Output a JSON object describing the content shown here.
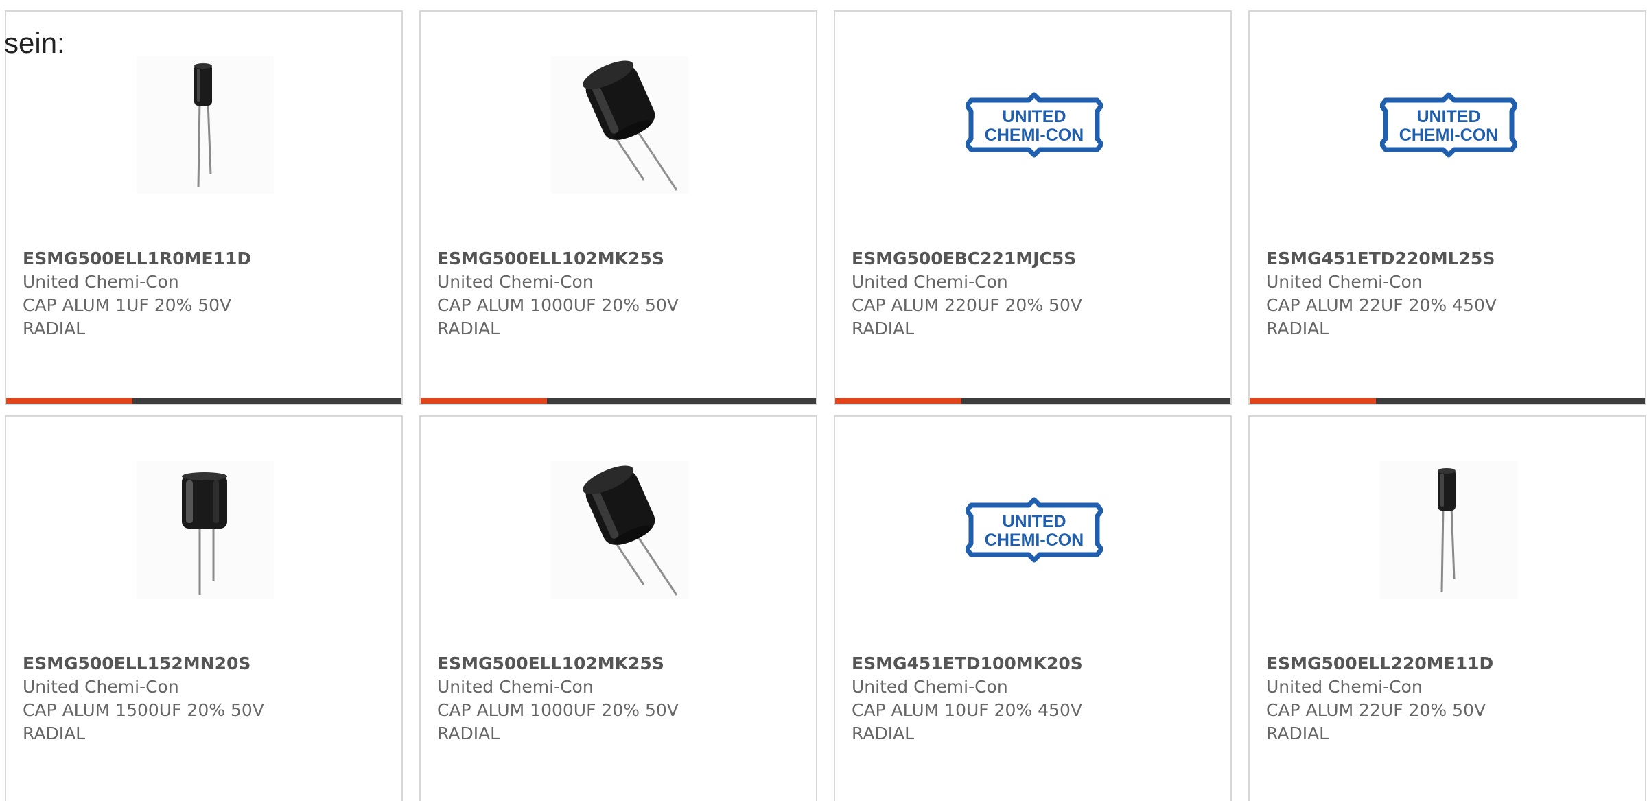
{
  "intro_text": "sein:",
  "colors": {
    "accent": "#e24419",
    "bar_track": "#3c3c3c",
    "card_border": "#d8d8d8",
    "logo_blue": "#1f5fae"
  },
  "products": [
    {
      "part_number": "ESMG500ELL1R0ME11D",
      "manufacturer": "United Chemi-Con",
      "description": "CAP ALUM 1UF 20% 50V RADIAL",
      "image": "capacitor-small-icon",
      "progress": 0.32
    },
    {
      "part_number": "ESMG500ELL102MK25S",
      "manufacturer": "United Chemi-Con",
      "description": "CAP ALUM 1000UF 20% 50V RADIAL",
      "image": "capacitor-tilted-icon",
      "progress": 0.32
    },
    {
      "part_number": "ESMG500EBC221MJC5S",
      "manufacturer": "United Chemi-Con",
      "description": "CAP ALUM 220UF 20% 50V RADIAL",
      "image": "united-chemi-con-logo",
      "progress": 0.32
    },
    {
      "part_number": "ESMG451ETD220ML25S",
      "manufacturer": "United Chemi-Con",
      "description": "CAP ALUM 22UF 20% 450V RADIAL",
      "image": "united-chemi-con-logo",
      "progress": 0.32
    },
    {
      "part_number": "ESMG500ELL152MN20S",
      "manufacturer": "United Chemi-Con",
      "description": "CAP ALUM 1500UF 20% 50V RADIAL",
      "image": "capacitor-wide-icon",
      "progress": 0.32
    },
    {
      "part_number": "ESMG500ELL102MK25S",
      "manufacturer": "United Chemi-Con",
      "description": "CAP ALUM 1000UF 20% 50V RADIAL",
      "image": "capacitor-tilted-icon",
      "progress": 0.32
    },
    {
      "part_number": "ESMG451ETD100MK20S",
      "manufacturer": "United Chemi-Con",
      "description": "CAP ALUM 10UF 20% 450V RADIAL",
      "image": "united-chemi-con-logo",
      "progress": 0.32
    },
    {
      "part_number": "ESMG500ELL220ME11D",
      "manufacturer": "United Chemi-Con",
      "description": "CAP ALUM 22UF 20% 50V RADIAL",
      "image": "capacitor-small-icon",
      "progress": 0.32
    }
  ],
  "logo": {
    "line1": "UNITED",
    "line2": "CHEMI-CON"
  }
}
